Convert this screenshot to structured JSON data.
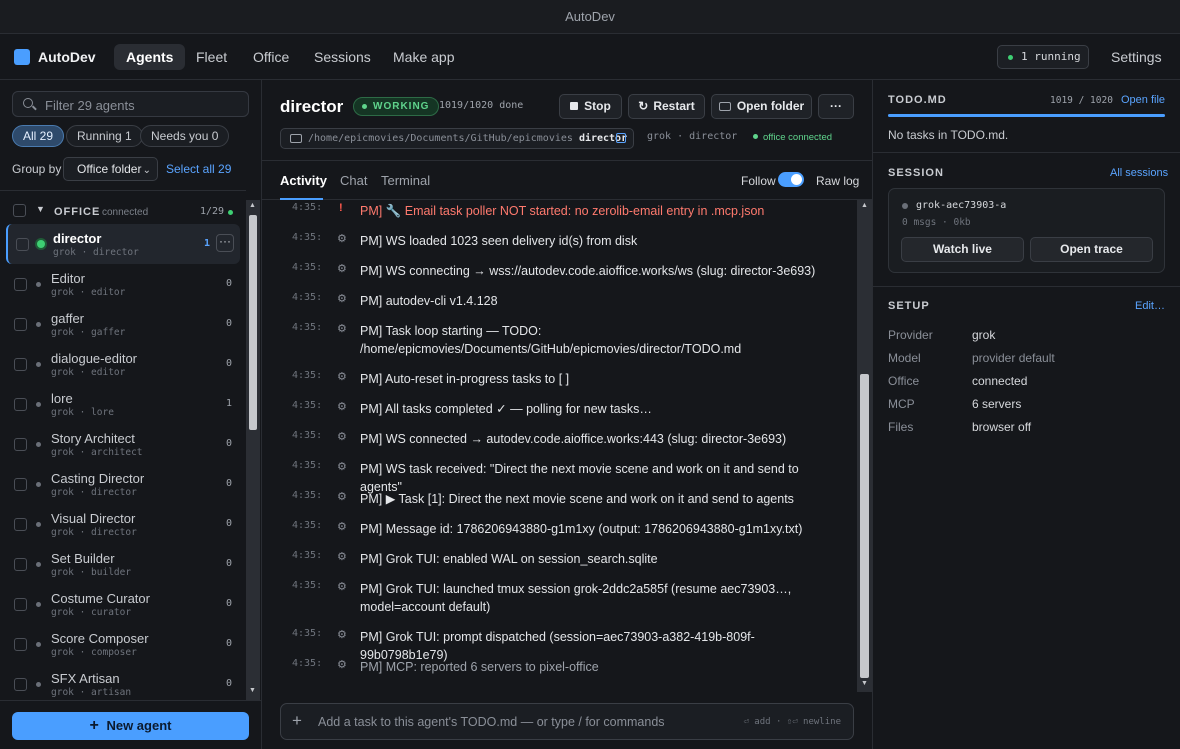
{
  "window": {
    "title": "AutoDev"
  },
  "topbar": {
    "brand": "AutoDev",
    "tabs": [
      "Agents",
      "Fleet",
      "Office",
      "Sessions",
      "Make app"
    ],
    "running": "1 running",
    "settings": "Settings"
  },
  "sidebar": {
    "search_placeholder": "Filter 29 agents",
    "filters": [
      "All 29",
      "Running 1",
      "Needs you 0"
    ],
    "group_by_label": "Group by",
    "group_by_value": "Office folder",
    "select_all": "Select all 29",
    "group": {
      "title": "OFFICE",
      "status": "connected",
      "count": "1/29"
    },
    "agents": [
      {
        "name": "director",
        "sub": "grok · director",
        "count": "1",
        "selected": true
      },
      {
        "name": "Editor",
        "sub": "grok · editor",
        "count": "0"
      },
      {
        "name": "gaffer",
        "sub": "grok · gaffer",
        "count": "0"
      },
      {
        "name": "dialogue-editor",
        "sub": "grok · editor",
        "count": "0"
      },
      {
        "name": "lore",
        "sub": "grok · lore",
        "count": "1"
      },
      {
        "name": "Story Architect",
        "sub": "grok · architect",
        "count": "0"
      },
      {
        "name": "Casting Director",
        "sub": "grok · director",
        "count": "0"
      },
      {
        "name": "Visual Director",
        "sub": "grok · director",
        "count": "0"
      },
      {
        "name": "Set Builder",
        "sub": "grok · builder",
        "count": "0"
      },
      {
        "name": "Costume Curator",
        "sub": "grok · curator",
        "count": "0"
      },
      {
        "name": "Score Composer",
        "sub": "grok · composer",
        "count": "0"
      },
      {
        "name": "SFX Artisan",
        "sub": "grok · artisan",
        "count": "0"
      }
    ],
    "more_button": "···",
    "new_agent": "New agent"
  },
  "main": {
    "title": "director",
    "status_badge": "WORKING",
    "done": "1019/1020 done",
    "buttons": {
      "stop": "Stop",
      "restart": "Restart",
      "open_folder": "Open folder",
      "more": "···"
    },
    "path_prefix": "/home/epicmovies/Documents/GitHub/epicmovies",
    "path_leaf": "director",
    "meta": "grok · director",
    "office_status": "office connected",
    "tabs": [
      "Activity",
      "Chat",
      "Terminal"
    ],
    "follow": "Follow",
    "raw_log": "Raw log",
    "log": [
      {
        "ts": "4:35:",
        "icon": "!",
        "text": "PM] 🔧 Email task poller NOT started: no zerolib-email entry in .mcp.json",
        "level": "error"
      },
      {
        "ts": "4:35:",
        "icon": "⚙",
        "text": "PM] WS loaded 1023 seen delivery id(s) from disk"
      },
      {
        "ts": "4:35:",
        "icon": "⚙",
        "text": "PM] WS connecting → wss://autodev.code.aioffice.works/ws (slug: director-3e693)"
      },
      {
        "ts": "4:35:",
        "icon": "⚙",
        "text": "PM] autodev-cli v1.4.128"
      },
      {
        "ts": "4:35:",
        "icon": "⚙",
        "text": "PM] Task loop starting — TODO: /home/epicmovies/Documents/GitHub/epicmovies/director/TODO.md",
        "lines": 2
      },
      {
        "ts": "4:35:",
        "icon": "⚙",
        "text": "PM] Auto-reset in-progress tasks to [ ]"
      },
      {
        "ts": "4:35:",
        "icon": "⚙",
        "text": "PM] All tasks completed ✓ — polling for new tasks…"
      },
      {
        "ts": "4:35:",
        "icon": "⚙",
        "text": "PM] WS connected → autodev.code.aioffice.works:443 (slug: director-3e693)"
      },
      {
        "ts": "4:35:",
        "icon": "⚙",
        "text": "PM] WS task received: \"Direct the next movie scene and work on it and send to agents\""
      },
      {
        "ts": "4:35:",
        "icon": "⚙",
        "text": "PM] ▶ Task [1]: Direct the next movie scene and work on it and send to agents"
      },
      {
        "ts": "4:35:",
        "icon": "⚙",
        "text": "PM] Message id: 1786206943880-g1m1xy (output: 1786206943880-g1m1xy.txt)"
      },
      {
        "ts": "4:35:",
        "icon": "⚙",
        "text": "PM] Grok TUI: enabled WAL on session_search.sqlite"
      },
      {
        "ts": "4:35:",
        "icon": "⚙",
        "text": "PM] Grok TUI: launched tmux session grok-2ddc2a585f (resume aec73903…, model=account default)",
        "lines": 2
      },
      {
        "ts": "4:35:",
        "icon": "⚙",
        "text": "PM] Grok TUI: prompt dispatched (session=aec73903-a382-419b-809f-99b0798b1e79)"
      },
      {
        "ts": "4:35:",
        "icon": "⚙",
        "text": "PM] MCP: reported 6 servers to pixel-office",
        "level": "dim"
      }
    ],
    "composer_placeholder": "Add a task to this agent's TODO.md — or type / for commands",
    "composer_hint": "⏎ add · ⇧⏎ newline"
  },
  "right": {
    "todo": {
      "title": "TODO.MD",
      "count": "1019 / 1020",
      "open_file": "Open file",
      "progress": 0.999,
      "empty": "No tasks in TODO.md."
    },
    "session": {
      "title": "SESSION",
      "all_sessions": "All sessions",
      "id": "grok-aec73903-a",
      "stats": "0 msgs · 0kb",
      "watch_live": "Watch live",
      "open_trace": "Open trace"
    },
    "setup": {
      "title": "SETUP",
      "edit": "Edit…",
      "rows": [
        {
          "key": "Provider",
          "value": "grok"
        },
        {
          "key": "Model",
          "value": "provider default",
          "dim": true
        },
        {
          "key": "Office",
          "value": "connected"
        },
        {
          "key": "MCP",
          "value": "6 servers"
        },
        {
          "key": "Files",
          "value": "browser off"
        }
      ]
    }
  },
  "colors": {
    "accent": "#4a9eff",
    "success": "#3ecf73",
    "error": "#ff5a4e"
  }
}
